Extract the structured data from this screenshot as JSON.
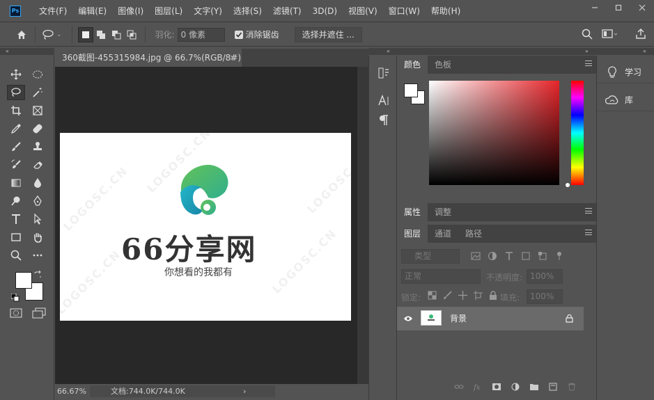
{
  "app": {
    "logo_text": "Ps"
  },
  "menu": [
    "文件(F)",
    "编辑(E)",
    "图像(I)",
    "图层(L)",
    "文字(Y)",
    "选择(S)",
    "滤镜(T)",
    "3D(D)",
    "视图(V)",
    "窗口(W)",
    "帮助(H)"
  ],
  "options": {
    "feather_label": "羽化:",
    "feather_value": "0 像素",
    "antialias_label": "消除锯齿",
    "select_mask_button": "选择并遮住 ..."
  },
  "document": {
    "tab_title": "360截图-455315984.jpg @ 66.7%(RGB/8#)",
    "close": "×",
    "image_title": "66分享网",
    "image_subtitle": "你想看的我都有",
    "watermark": "LOGOSC.CN"
  },
  "status": {
    "zoom": "66.67%",
    "doc_size": "文档:744.0K/744.0K",
    "arrow": "›"
  },
  "color_panel": {
    "tabs": [
      "颜色",
      "色板"
    ]
  },
  "properties_panel": {
    "tabs": [
      "属性",
      "调整"
    ]
  },
  "layers_panel": {
    "tabs": [
      "图层",
      "通道",
      "路径"
    ],
    "filter_placeholder": "类型",
    "blend_mode": "正常",
    "opacity_label": "不透明度:",
    "opacity_value": "100%",
    "lock_label": "锁定:",
    "fill_label": "填充:",
    "fill_value": "100%",
    "layers": [
      {
        "name": "背景"
      }
    ]
  },
  "side_panels": [
    {
      "label": "学习",
      "icon": "lightbulb-icon"
    },
    {
      "label": "库",
      "icon": "libraries-icon"
    }
  ]
}
